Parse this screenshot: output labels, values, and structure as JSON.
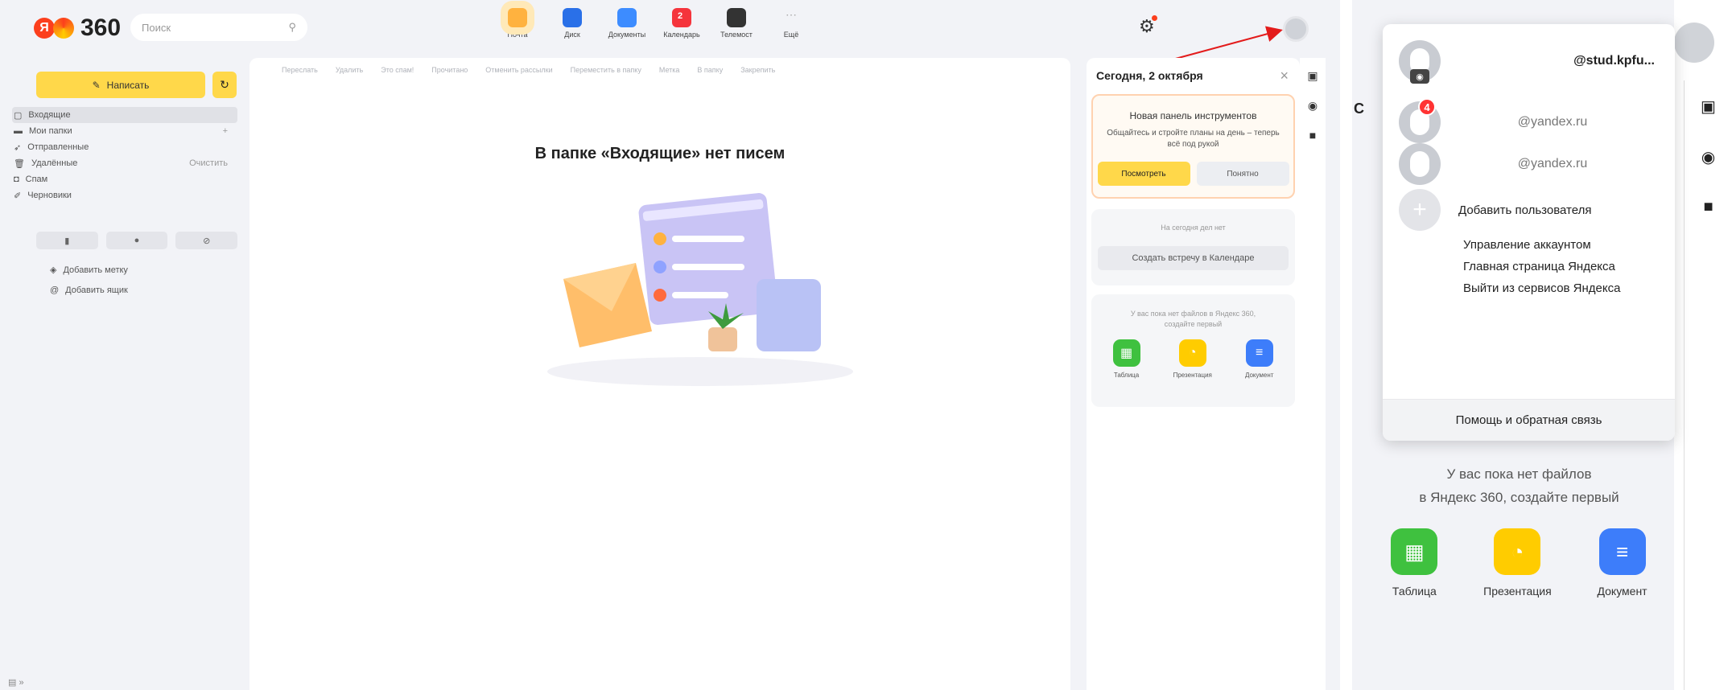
{
  "header": {
    "logo_text": "360",
    "search_placeholder": "Поиск",
    "apps": [
      {
        "label": "Почта",
        "color": "#ffb23f"
      },
      {
        "label": "Диск",
        "color": "#2a70e8"
      },
      {
        "label": "Документы",
        "color": "#3d8cff"
      },
      {
        "label": "Календарь",
        "color": "#f5343c",
        "badge": "2"
      },
      {
        "label": "Телемост",
        "color": "#333333"
      },
      {
        "label": "Ещё",
        "color": "#dddddd"
      }
    ]
  },
  "sidebar": {
    "compose_label": "Написать",
    "folders": [
      {
        "label": "Входящие",
        "icon": "inbox-icon"
      },
      {
        "label": "Мои папки",
        "icon": "folder-icon",
        "right": "+"
      },
      {
        "label": "Отправленные",
        "icon": "send-icon"
      },
      {
        "label": "Удалённые",
        "icon": "trash-icon",
        "right": "Очистить"
      },
      {
        "label": "Спам",
        "icon": "spam-icon"
      },
      {
        "label": "Черновики",
        "icon": "drafts-icon"
      }
    ],
    "add_label": "Добавить метку",
    "add_box": "Добавить ящик"
  },
  "toolbar": [
    "Переслать",
    "Удалить",
    "Это спам!",
    "Прочитано",
    "Отменить рассылки",
    "Переместить в папку",
    "Метка",
    "В папку",
    "Закрепить"
  ],
  "main": {
    "empty_text": "В папке «Входящие» нет писем"
  },
  "today_panel": {
    "title": "Сегодня, 2 октября",
    "promo_title": "Новая панель инструментов",
    "promo_text": "Общайтесь и стройте планы на день – теперь всё под рукой",
    "promo_view": "Посмотреть",
    "promo_ok": "Понятно",
    "no_events": "На сегодня дел нет",
    "create_meeting": "Создать встречу в Календаре",
    "no_files": "У вас пока нет файлов в Яндекс 360, создайте первый",
    "files": [
      {
        "label": "Таблица",
        "color": "#3fc13f"
      },
      {
        "label": "Презентация",
        "color": "#ffcc00"
      },
      {
        "label": "Документ",
        "color": "#3d7dfa"
      }
    ]
  },
  "account_menu": {
    "accounts": [
      {
        "name": "@stud.kpfu..."
      },
      {
        "name": "@yandex.ru",
        "badge": "4"
      },
      {
        "name": "@yandex.ru"
      }
    ],
    "add_user": "Добавить пользователя",
    "manage": "Управление аккаунтом",
    "home": "Главная страница Яндекса",
    "logout": "Выйти из сервисов Яндекса",
    "help": "Помощь и обратная связь"
  },
  "zoom": {
    "partial_letter": "С",
    "files_line1": "У вас пока нет файлов",
    "files_line2": "в Яндекс 360, создайте первый"
  }
}
